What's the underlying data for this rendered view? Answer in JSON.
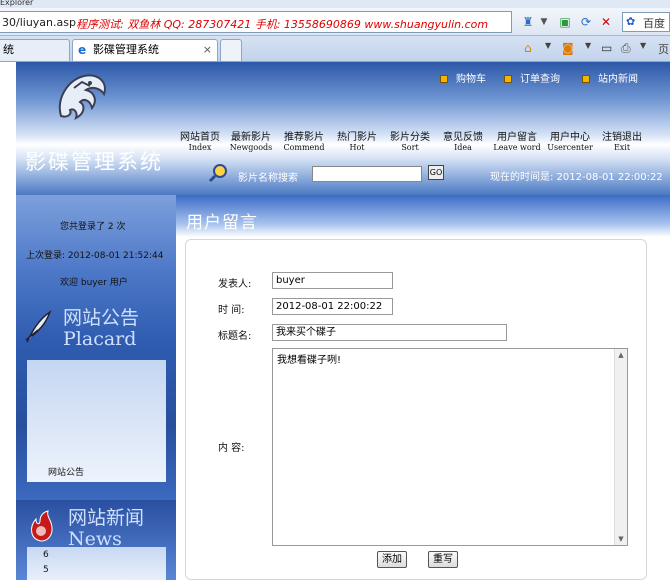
{
  "browser": {
    "title_text": "Explorer",
    "url": "30/liuyan.asp",
    "ad_text": "程序测试: 双鱼林  QQ: 287307421  手机: 13558690869  www.shuangyulin.com",
    "search_box_text": "百度一",
    "tabs": [
      {
        "label": "统"
      },
      {
        "label": "影碟管理系统"
      }
    ],
    "page_menu_label": "页"
  },
  "header": {
    "site_title": "影碟管理系统",
    "top_links": [
      "购物车",
      "订单查询",
      "站内新闻"
    ],
    "nav": [
      {
        "cn": "网站首页",
        "en": "Index"
      },
      {
        "cn": "最新影片",
        "en": "Newgoods"
      },
      {
        "cn": "推荐影片",
        "en": "Commend"
      },
      {
        "cn": "热门影片",
        "en": "Hot"
      },
      {
        "cn": "影片分类",
        "en": "Sort"
      },
      {
        "cn": "意见反馈",
        "en": "Idea"
      },
      {
        "cn": "用户留言",
        "en": "Leave word"
      },
      {
        "cn": "用户中心",
        "en": "Usercenter"
      },
      {
        "cn": "注销退出",
        "en": "Exit"
      }
    ],
    "search_label": "影片名称搜索",
    "search_value": "",
    "go_label": "GO",
    "current_time": "现在的时间是: 2012-08-01 22:00:22"
  },
  "sidebar": {
    "login_count": "您共登录了 2 次",
    "last_login": "上次登录: 2012-08-01 21:52:44",
    "welcome": "欢迎 buyer 用户",
    "placard_cn": "网站公告",
    "placard_en": "Placard",
    "notice_label": "网站公告",
    "news_cn": "网站新闻",
    "news_en": "News",
    "news_items": [
      "6",
      "5"
    ]
  },
  "main": {
    "title": "用户留言",
    "form": {
      "author_label": "发表人:",
      "author_value": "buyer",
      "time_label": "时  间:",
      "time_value": "2012-08-01 22:00:22",
      "subject_label": "标题名:",
      "subject_value": "我来买个碟子",
      "content_label": "内  容:",
      "content_value": "我想看碟子咧!",
      "submit_label": "添加",
      "reset_label": "重写"
    }
  },
  "colors": {
    "header_blue": "#2c58a8",
    "sidebar_blue": "#2f5cb0",
    "accent_orange": "#f5b400"
  }
}
